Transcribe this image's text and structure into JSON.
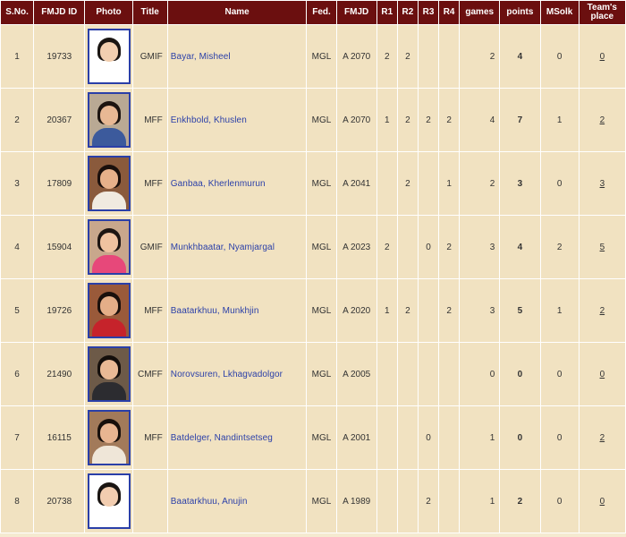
{
  "headers": {
    "sno": "S.No.",
    "fmjd_id": "FMJD ID",
    "photo": "Photo",
    "title": "Title",
    "name": "Name",
    "fed": "Fed.",
    "fmjd": "FMJD",
    "r1": "R1",
    "r2": "R2",
    "r3": "R3",
    "r4": "R4",
    "games": "games",
    "points": "points",
    "msolk": "MSolk",
    "team_place": "Team's place"
  },
  "rows": [
    {
      "sno": "1",
      "id": "19733",
      "title": "GMIF",
      "name": "Bayar, Misheel",
      "fed": "MGL",
      "fmjd": "A 2070",
      "r1": "2",
      "r2": "2",
      "r3": "",
      "r4": "",
      "games": "2",
      "points": "4",
      "msolk": "0",
      "place": "0",
      "photo": {
        "bg": "#ffffff",
        "hair": "#1a1512",
        "face": "#f2cfb0",
        "body": "#ffffff"
      }
    },
    {
      "sno": "2",
      "id": "20367",
      "title": "MFF",
      "name": "Enkhbold, Khuslen",
      "fed": "MGL",
      "fmjd": "A 2070",
      "r1": "1",
      "r2": "2",
      "r3": "2",
      "r4": "2",
      "games": "4",
      "points": "7",
      "msolk": "1",
      "place": "2",
      "photo": {
        "bg": "#b9a994",
        "hair": "#1c1410",
        "face": "#e8b894",
        "body": "#3c5a9c"
      }
    },
    {
      "sno": "3",
      "id": "17809",
      "title": "MFF",
      "name": "Ganbaa, Kherlenmurun",
      "fed": "MGL",
      "fmjd": "A 2041",
      "r1": "",
      "r2": "2",
      "r3": "",
      "r4": "1",
      "games": "2",
      "points": "3",
      "msolk": "0",
      "place": "3",
      "photo": {
        "bg": "#8a5a3c",
        "hair": "#1a0f0c",
        "face": "#e6b08a",
        "body": "#f0eae0"
      }
    },
    {
      "sno": "4",
      "id": "15904",
      "title": "GMIF",
      "name": "Munkhbaatar, Nyamjargal",
      "fed": "MGL",
      "fmjd": "A 2023",
      "r1": "2",
      "r2": "",
      "r3": "0",
      "r4": "2",
      "games": "3",
      "points": "4",
      "msolk": "2",
      "place": "5",
      "photo": {
        "bg": "#c8a78c",
        "hair": "#1d1512",
        "face": "#efc2a0",
        "body": "#e7487a"
      }
    },
    {
      "sno": "5",
      "id": "19726",
      "title": "MFF",
      "name": "Baatarkhuu, Munkhjin",
      "fed": "MGL",
      "fmjd": "A 2020",
      "r1": "1",
      "r2": "2",
      "r3": "",
      "r4": "2",
      "games": "3",
      "points": "5",
      "msolk": "1",
      "place": "2",
      "photo": {
        "bg": "#9a5a3a",
        "hair": "#1a100c",
        "face": "#e4ae88",
        "body": "#c6232b"
      }
    },
    {
      "sno": "6",
      "id": "21490",
      "title": "CMFF",
      "name": "Norovsuren, Lkhagvadolgor",
      "fed": "MGL",
      "fmjd": "A 2005",
      "r1": "",
      "r2": "",
      "r3": "",
      "r4": "",
      "games": "0",
      "points": "0",
      "msolk": "0",
      "place": "0",
      "photo": {
        "bg": "#6d5a48",
        "hair": "#140e0b",
        "face": "#e9b995",
        "body": "#2c2c30"
      }
    },
    {
      "sno": "7",
      "id": "16115",
      "title": "MFF",
      "name": "Batdelger, Nandintsetseg",
      "fed": "MGL",
      "fmjd": "A 2001",
      "r1": "",
      "r2": "",
      "r3": "0",
      "r4": "",
      "games": "1",
      "points": "0",
      "msolk": "0",
      "place": "2",
      "photo": {
        "bg": "#a27a5a",
        "hair": "#170f0b",
        "face": "#e8b591",
        "body": "#efe6d8"
      }
    },
    {
      "sno": "8",
      "id": "20738",
      "title": "",
      "name": "Baatarkhuu, Anujin",
      "fed": "MGL",
      "fmjd": "A 1989",
      "r1": "",
      "r2": "",
      "r3": "2",
      "r4": "",
      "games": "1",
      "points": "2",
      "msolk": "0",
      "place": "0",
      "photo": {
        "bg": "#ffffff",
        "hair": "#1a1512",
        "face": "#f2cdb0",
        "body": "#ffffff"
      }
    }
  ]
}
